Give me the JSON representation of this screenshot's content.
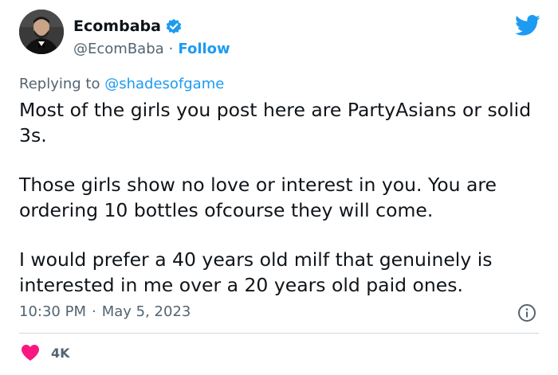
{
  "author": {
    "display_name": "Ecombaba",
    "handle": "@EcomBaba",
    "follow_label": "Follow",
    "verified": true,
    "separator": "·"
  },
  "reply": {
    "prefix": "Replying to ",
    "mention": "@shadesofgame"
  },
  "tweet": {
    "paragraphs": [
      "Most of the girls you post here are PartyAsians or solid 3s.",
      "Those girls show no love or interest in you. You are ordering 10 bottles ofcourse they will come.",
      "I would prefer a 40 years old milf that genuinely is interested in me over a 20 years old paid ones."
    ],
    "time": "10:30 PM",
    "separator": "·",
    "date": "May 5, 2023",
    "like_count": "4K"
  },
  "icons": {
    "logo": "twitter-bird-icon",
    "verified": "verified-badge-icon",
    "info": "info-icon",
    "like": "heart-icon"
  },
  "colors": {
    "accent": "#1d9bf0",
    "text": "#0f1419",
    "secondary": "#536471",
    "like": "#f91880",
    "divider": "#cfd9de"
  }
}
